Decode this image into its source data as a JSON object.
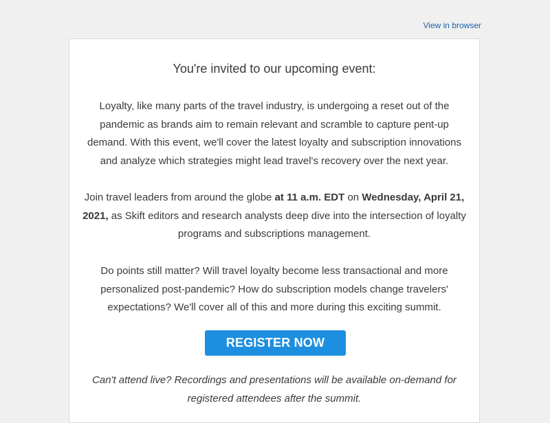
{
  "header": {
    "view_in_browser": "View in browser"
  },
  "email": {
    "heading": "You're invited to our upcoming event:",
    "paragraph1": "Loyalty, like many parts of the travel industry, is undergoing a reset out of the pandemic as brands aim to remain relevant and scramble to capture pent-up demand. With this event, we'll cover the latest loyalty and subscription innovations and analyze which strategies might lead travel's recovery over the next year.",
    "paragraph2": {
      "before_time": "Join travel leaders from around the globe ",
      "time": "at 11 a.m. EDT",
      "between": " on ",
      "date": "Wednesday, April 21, 2021,",
      "after_date": " as Skift editors and research analysts deep dive into the intersection of loyalty programs and subscriptions management."
    },
    "paragraph3": "Do points still matter? Will travel loyalty become less transactional and more personalized post-pandemic? How do subscription models change travelers' expectations? We'll cover all of this and more during this exciting summit.",
    "register_label": "REGISTER NOW",
    "paragraph4": "Can't attend live? Recordings and presentations will be available on-demand for registered attendees after the summit."
  },
  "colors": {
    "background": "#f0f0f0",
    "card": "#ffffff",
    "link": "#1a5fa8",
    "button": "#1d8fe0",
    "text": "#3a3a3a"
  }
}
